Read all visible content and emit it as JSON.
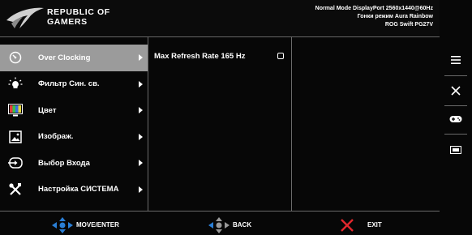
{
  "header": {
    "brand_line1": "REPUBLIC OF",
    "brand_line2": "GAMERS",
    "status_line1": "Normal Mode DisplayPort 2560x1440@60Hz",
    "status_line2": "Гонки режим Aura Rainbow",
    "status_line3": "ROG Swift PG27V"
  },
  "menu": {
    "items": [
      {
        "label": "Over Clocking",
        "icon": "gauge-icon",
        "selected": true
      },
      {
        "label": "Фильтр Син. св.",
        "icon": "light-bulb-icon",
        "selected": false
      },
      {
        "label": "Цвет",
        "icon": "color-bars-icon",
        "selected": false
      },
      {
        "label": "Изображ.",
        "icon": "image-icon",
        "selected": false
      },
      {
        "label": "Выбор Входа",
        "icon": "input-icon",
        "selected": false
      },
      {
        "label": "Настройка СИСТЕМА",
        "icon": "tools-icon",
        "selected": false
      }
    ]
  },
  "submenu": {
    "option_label": "Max Refresh Rate 165 Hz",
    "option_checked": false
  },
  "footer": {
    "move_label": "MOVE/ENTER",
    "back_label": "BACK",
    "exit_label": "EXIT"
  },
  "side_buttons": [
    "menu-icon",
    "close-icon",
    "gamepad-icon",
    "gameplus-icon"
  ],
  "colors": {
    "selected_bg": "#9b9b9b",
    "joystick_blue": "#2a7fd6",
    "exit_red": "#e2272d",
    "background": "#070707"
  }
}
